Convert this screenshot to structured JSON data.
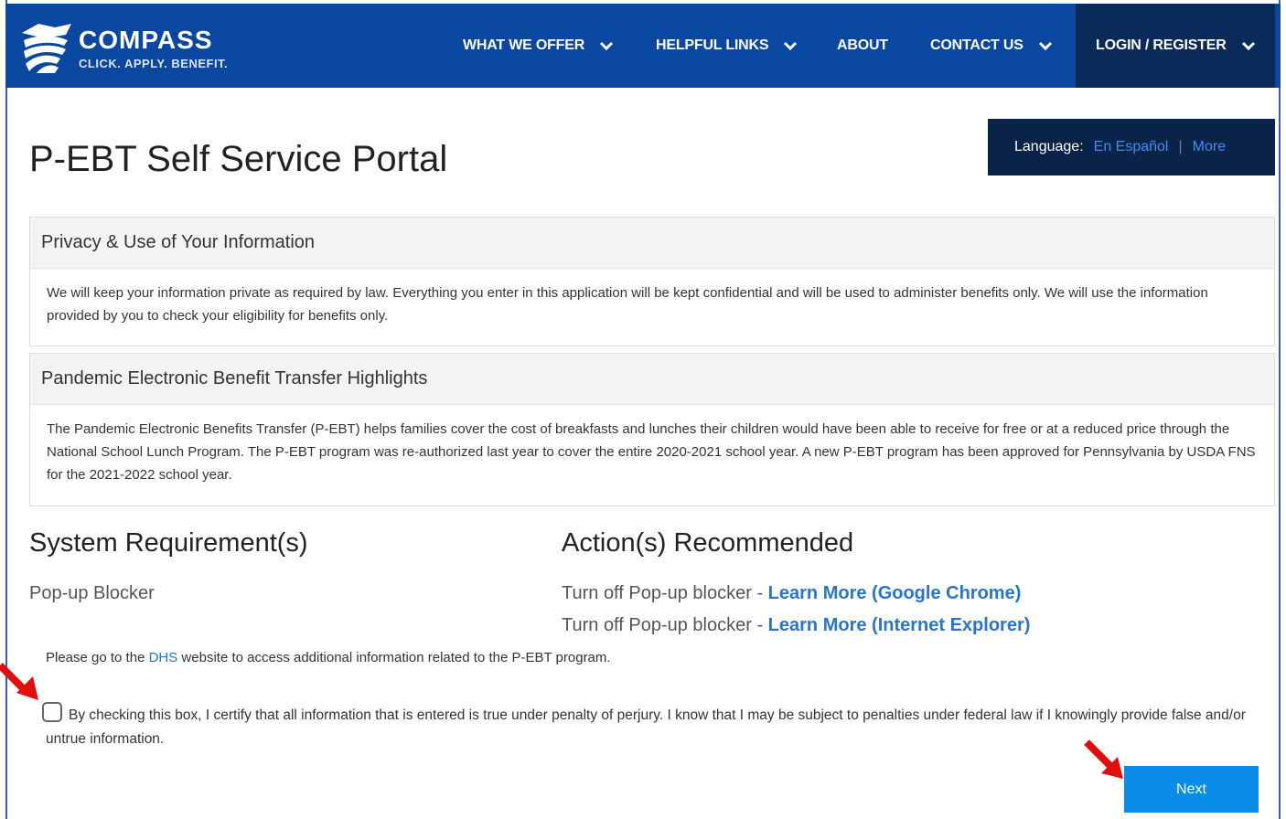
{
  "header": {
    "brand_name": "COMPASS",
    "brand_tagline": "CLICK. APPLY. BENEFIT.",
    "nav": [
      {
        "label": "WHAT WE OFFER",
        "has_dropdown": true
      },
      {
        "label": "HELPFUL LINKS",
        "has_dropdown": true
      },
      {
        "label": "ABOUT",
        "has_dropdown": false
      },
      {
        "label": "CONTACT US",
        "has_dropdown": true
      },
      {
        "label": "LOGIN / REGISTER",
        "has_dropdown": true
      }
    ]
  },
  "language": {
    "label": "Language:",
    "espanol": "En Español",
    "separator": "|",
    "more": "More"
  },
  "page_title": "P-EBT Self Service Portal",
  "privacy": {
    "heading": "Privacy & Use of Your Information",
    "body": "We will keep your information private as required by law. Everything you enter in this application will be kept confidential and will be used to administer benefits only. We will use the information provided by you to check your eligibility for benefits only."
  },
  "highlights": {
    "heading": "Pandemic Electronic Benefit Transfer Highlights",
    "body": "The Pandemic Electronic Benefits Transfer (P-EBT) helps families cover the cost of breakfasts and lunches their children would have been able to receive for free or at a reduced price through the National School Lunch Program. The P-EBT program was re-authorized last year to cover the entire 2020-2021 school year. A new P-EBT program has been approved for Pennsylvania by USDA FNS for the 2021-2022 school year."
  },
  "requirements": {
    "heading": "System Requirement(s)",
    "item": "Pop-up Blocker"
  },
  "actions": {
    "heading": "Action(s) Recommended",
    "lines": [
      {
        "prefix": "Turn off Pop-up blocker - ",
        "link": "Learn More (Google Chrome)"
      },
      {
        "prefix": "Turn off Pop-up blocker - ",
        "link": "Learn More (Internet Explorer)"
      }
    ]
  },
  "dhs": {
    "before": "Please go to the ",
    "link": "DHS",
    "after": " website to access additional information related to the P-EBT program."
  },
  "certify": {
    "text": "By checking this box, I certify that all information that is entered is true under penalty of perjury. I know that I may be subject to penalties under federal law if I knowingly provide false and/or untrue information.",
    "checked": false
  },
  "next_button": "Next",
  "colors": {
    "header_bg": "#0a47a0",
    "login_bg": "#0a2a5a",
    "lang_bg": "#0a2449",
    "link": "#2a75c7",
    "button": "#0a8de8",
    "annotation_arrow": "#e01010"
  }
}
